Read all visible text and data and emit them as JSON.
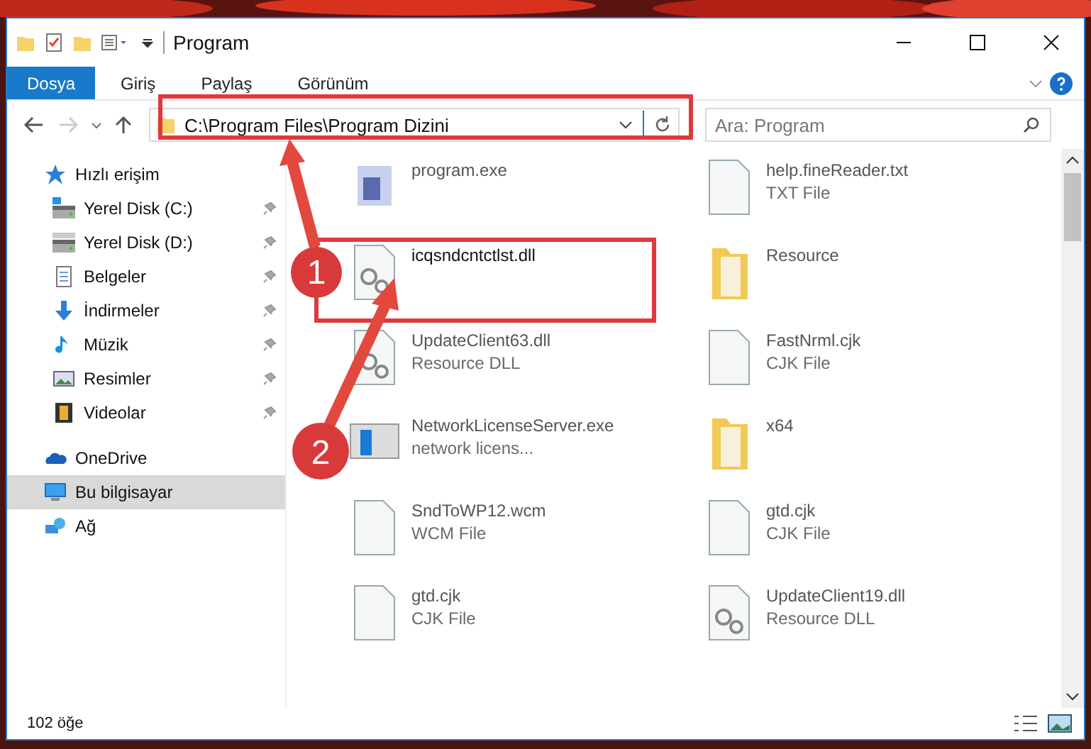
{
  "window": {
    "title": "Program"
  },
  "ribbon_tabs": [
    {
      "label": "Dosya",
      "selected": true
    },
    {
      "label": "Giriş",
      "selected": false
    },
    {
      "label": "Paylaş",
      "selected": false
    },
    {
      "label": "Görünüm",
      "selected": false
    }
  ],
  "address": {
    "value": "C:\\Program Files\\Program Dizini"
  },
  "search": {
    "placeholder": "Ara: Program"
  },
  "sidebar": {
    "items": [
      {
        "kind": "quick",
        "label": "Hızlı erişim",
        "pinned": false,
        "selected": false,
        "children": [
          {
            "kind": "drive-c",
            "label": "Yerel Disk (C:)",
            "pinned": true,
            "selected": false
          },
          {
            "kind": "drive",
            "label": "Yerel Disk (D:)",
            "pinned": true,
            "selected": false
          },
          {
            "kind": "docs",
            "label": "Belgeler",
            "pinned": true,
            "selected": false
          },
          {
            "kind": "download",
            "label": "İndirmeler",
            "pinned": true,
            "selected": false
          },
          {
            "kind": "music",
            "label": "Müzik",
            "pinned": true,
            "selected": false
          },
          {
            "kind": "pictures",
            "label": "Resimler",
            "pinned": true,
            "selected": false
          },
          {
            "kind": "videos",
            "label": "Videolar",
            "pinned": true,
            "selected": false
          }
        ]
      },
      {
        "kind": "cloud",
        "label": "OneDrive",
        "pinned": false,
        "selected": false
      },
      {
        "kind": "pc",
        "label": "Bu bilgisayar",
        "pinned": false,
        "selected": true
      },
      {
        "kind": "network",
        "label": "Ağ",
        "pinned": false,
        "selected": false
      }
    ]
  },
  "files": [
    {
      "kind": "app",
      "name": "program.exe",
      "blurred": true
    },
    {
      "kind": "txt",
      "name": "help.fineReader.txt",
      "type": "TXT File",
      "blurred": true
    },
    {
      "kind": "dll",
      "name": "icqsndcntctlst.dll",
      "blurred": false
    },
    {
      "kind": "folder",
      "name": "Resource",
      "blurred": true
    },
    {
      "kind": "dll",
      "name": "UpdateClient63.dll",
      "type": "Resource DLL",
      "blurred": true
    },
    {
      "kind": "txt",
      "name": "FastNrml.cjk",
      "type": "CJK File",
      "blurred": true
    },
    {
      "kind": "window",
      "name": "NetworkLicenseServer.exe",
      "type": "network licens...",
      "blurred": true
    },
    {
      "kind": "folder",
      "name": "x64",
      "blurred": true
    },
    {
      "kind": "txt",
      "name": "SndToWP12.wcm",
      "type": "WCM File",
      "blurred": true
    },
    {
      "kind": "txt",
      "name": "gtd.cjk",
      "type": "CJK File",
      "blurred": true
    },
    {
      "kind": "txt",
      "name": "gtd.cjk",
      "type": "CJK File",
      "blurred": true
    },
    {
      "kind": "dll",
      "name": "UpdateClient19.dll",
      "type": "Resource DLL",
      "blurred": true
    }
  ],
  "status_bar": {
    "count": "102 öğe"
  },
  "annotations": [
    {
      "label": "1"
    },
    {
      "label": "2"
    }
  ]
}
